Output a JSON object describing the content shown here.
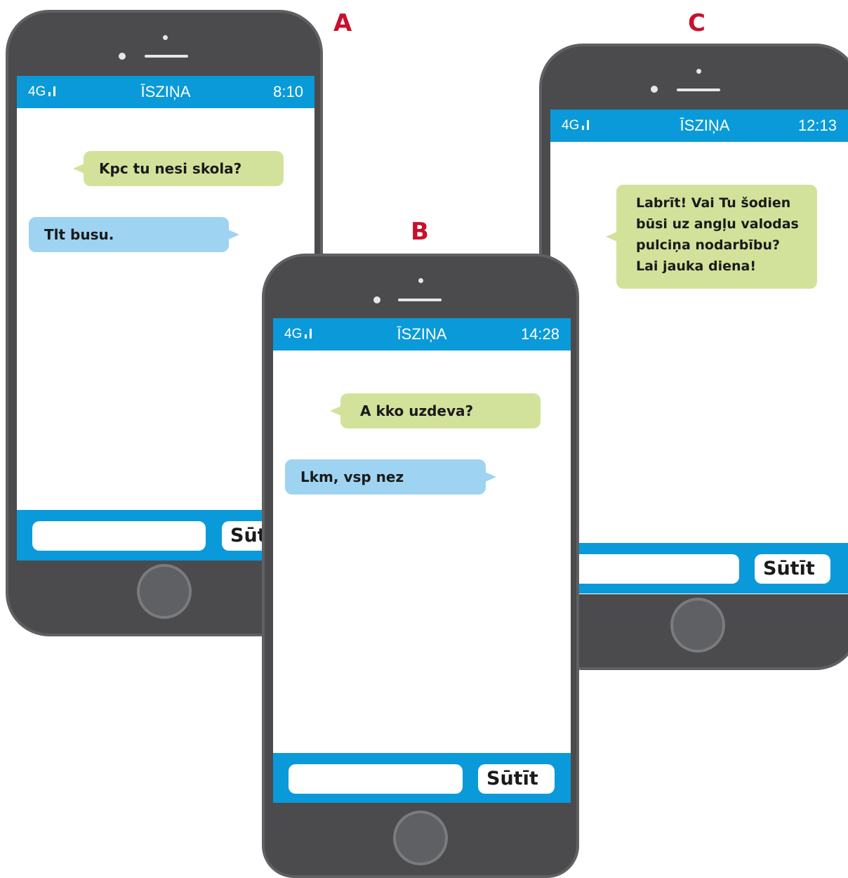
{
  "labels": {
    "a": "A",
    "b": "B",
    "c": "C"
  },
  "phones": {
    "a": {
      "network": "4G",
      "title": "ĪSZIŅA",
      "time": "8:10",
      "messages": [
        {
          "text": "Kpc tu nesi skola?",
          "side": "received"
        },
        {
          "text": "Tlt busu.",
          "side": "sent"
        }
      ],
      "send_label": "Sūtīt",
      "input_value": ""
    },
    "b": {
      "network": "4G",
      "title": "ĪSZIŅA",
      "time": "14:28",
      "messages": [
        {
          "text": "A kko uzdeva?",
          "side": "received"
        },
        {
          "text": "Lkm, vsp nez",
          "side": "sent"
        }
      ],
      "send_label": "Sūtīt",
      "input_value": ""
    },
    "c": {
      "network": "4G",
      "title": "ĪSZIŅA",
      "time": "12:13",
      "messages": [
        {
          "text": "Labrīt! Vai Tu šodien būsi uz angļu valodas pulciņa nodarbību? Lai jauka diena!",
          "side": "received"
        }
      ],
      "send_label": "Sūtīt",
      "input_value": ""
    }
  },
  "colors": {
    "label_red": "#c8102e",
    "status_blue": "#0a9ad9",
    "received_bubble": "#d3e29b",
    "sent_bubble": "#9fd3f2",
    "phone_body": "#4b4b4d"
  }
}
